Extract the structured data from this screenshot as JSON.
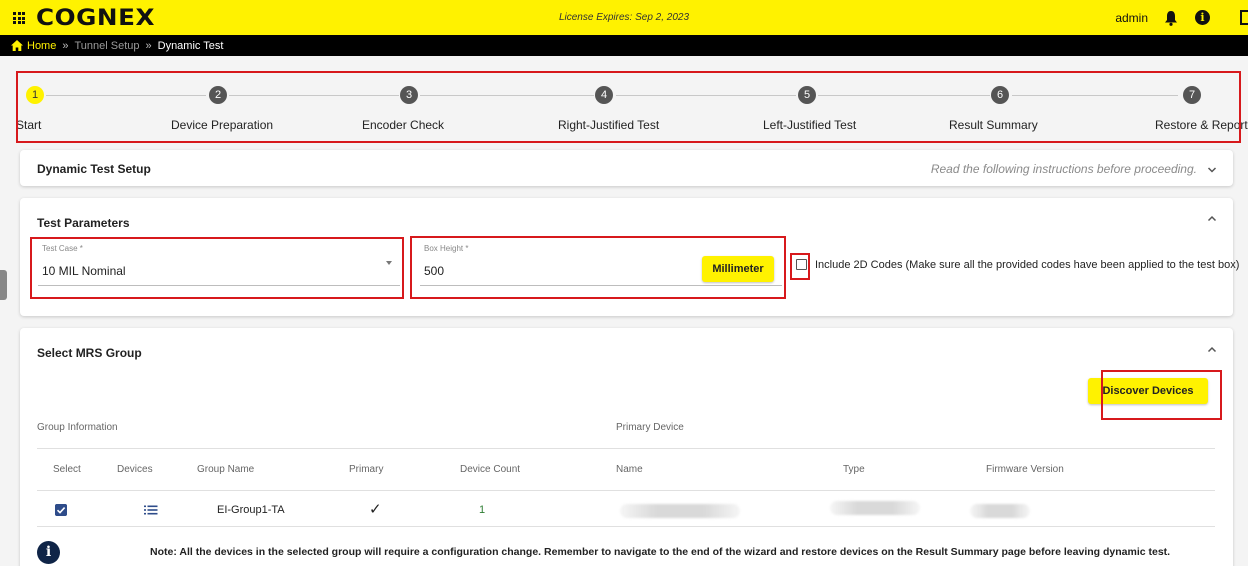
{
  "header": {
    "logo": "COGNEX",
    "license": "License Expires: Sep 2, 2023",
    "user": "admin",
    "icons": [
      "apps-grid-icon",
      "bell-icon",
      "info-icon",
      "logout-icon"
    ]
  },
  "breadcrumb": {
    "home": "Home",
    "separator": "»",
    "middle": "Tunnel Setup",
    "current": "Dynamic Test"
  },
  "stepper": {
    "active_step": 1,
    "steps": [
      {
        "number": "1",
        "label": "Start"
      },
      {
        "number": "2",
        "label": "Device Preparation"
      },
      {
        "number": "3",
        "label": "Encoder Check"
      },
      {
        "number": "4",
        "label": "Right-Justified Test"
      },
      {
        "number": "5",
        "label": "Left-Justified Test"
      },
      {
        "number": "6",
        "label": "Result Summary"
      },
      {
        "number": "7",
        "label": "Restore & Report"
      }
    ]
  },
  "setup": {
    "title": "Dynamic Test Setup",
    "hint": "Read the following instructions before proceeding.",
    "expanded": false
  },
  "params": {
    "title": "Test Parameters",
    "test_case_label": "Test Case *",
    "test_case_value": "10 MIL Nominal",
    "box_height_label": "Box Height *",
    "box_height_value": "500",
    "unit_button": "Millimeter",
    "include_2d_label": "Include 2D Codes (Make sure all the provided codes have been applied to the test box)",
    "include_2d_checked": false
  },
  "mrs": {
    "title": "Select MRS Group",
    "discover_button": "Discover Devices",
    "group_info_header": "Group Information",
    "primary_device_header": "Primary Device",
    "columns": [
      "Select",
      "Devices",
      "Group Name",
      "Primary",
      "Device Count",
      "Name",
      "Type",
      "Firmware Version"
    ],
    "rows": [
      {
        "selected": true,
        "group_name": "EI-Group1-TA",
        "primary": "✓",
        "device_count": "1"
      }
    ]
  },
  "note": "Note: All the devices in the selected group will require a configuration change. Remember to navigate to the end of the wizard and restore devices on the Result Summary page before leaving dynamic test.",
  "colors": {
    "brand_yellow": "#fff200",
    "annotation_red": "#d7191c",
    "checkbox_blue": "#2e4c8a",
    "count_green": "#2e7d32"
  }
}
